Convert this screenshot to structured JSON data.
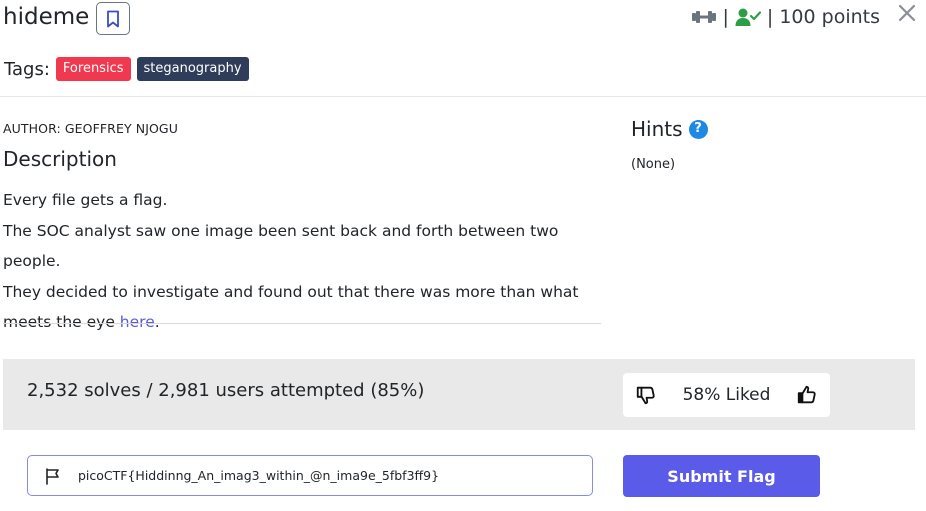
{
  "challenge": {
    "title": "hideme",
    "points_label": "100 points",
    "separator": "|",
    "tags_label": "Tags:",
    "tags": [
      {
        "label": "Forensics",
        "color": "#f0384f"
      },
      {
        "label": "steganography",
        "color": "#2f3d5a"
      }
    ]
  },
  "icons": {
    "bookmark": "bookmark-icon",
    "difficulty": "dumbbell-icon",
    "solved_user": "user-check-icon",
    "close": "close-icon",
    "help": "question-circle-icon",
    "dislike": "thumbs-down-icon",
    "like": "thumbs-up-icon",
    "flag": "flag-icon"
  },
  "description": {
    "author": "AUTHOR: GEOFFREY NJOGU",
    "heading": "Description",
    "line1": "Every file gets a flag.",
    "line2": "The SOC analyst saw one image been sent back and forth between two people.",
    "line3": "They decided to investigate and found out that there was more than what",
    "line4_prefix": "meets the eye ",
    "link_text": "here",
    "line4_suffix": "."
  },
  "hints": {
    "heading": "Hints",
    "help_glyph": "?",
    "body": "(None)"
  },
  "stats": {
    "solves_text": "2,532 solves / 2,981 users attempted (85%)",
    "liked_text": "58% Liked"
  },
  "flag_form": {
    "value": "picoCTF{Hiddinng_An_imag3_within_@n_ima9e_5fbf3ff9}",
    "submit_label": "Submit Flag"
  },
  "colors": {
    "accent": "#5b5bea",
    "success": "#2e9e44",
    "help_blue": "#1e88e5",
    "stats_bg": "#e9e9e9"
  }
}
